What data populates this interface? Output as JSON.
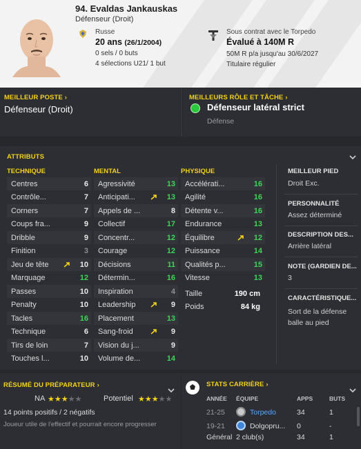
{
  "header": {
    "name": "94. Evaldas Jankauskas",
    "position": "Défenseur (Droit)",
    "nationality": "Russe",
    "age": "20 ans",
    "dob": "(26/1/2004)",
    "caps": "0 sels / 0 buts",
    "u21": "4 sélections U21/ 1 but",
    "contract": "Sous contrat avec le Torpedo",
    "value": "Évalué à 140M R",
    "wage": "50M R p/a jusqu'au 30/6/2027",
    "status": "Titulaire régulier"
  },
  "best_position": {
    "title": "Meilleur poste",
    "value": "Défenseur (Droit)"
  },
  "best_role": {
    "title": "Meilleurs rôle et tâche",
    "value": "Défenseur latéral strict",
    "sub": "Défense"
  },
  "attributes": {
    "title": "Attributs",
    "technique_title": "Technique",
    "mental_title": "Mental",
    "physique_title": "Physique",
    "technique": [
      {
        "name": "Centres",
        "value": "6",
        "color": "white"
      },
      {
        "name": "Contrôle...",
        "value": "7",
        "color": "white"
      },
      {
        "name": "Corners",
        "value": "7",
        "color": "white"
      },
      {
        "name": "Coups fra...",
        "value": "9",
        "color": "white"
      },
      {
        "name": "Dribble",
        "value": "9",
        "color": "white"
      },
      {
        "name": "Finition",
        "value": "3",
        "color": "grey"
      },
      {
        "name": "Jeu de tête",
        "value": "10",
        "color": "white",
        "trend": true
      },
      {
        "name": "Marquage",
        "value": "12",
        "color": "green"
      },
      {
        "name": "Passes",
        "value": "10",
        "color": "white"
      },
      {
        "name": "Penalty",
        "value": "10",
        "color": "white"
      },
      {
        "name": "Tacles",
        "value": "16",
        "color": "green"
      },
      {
        "name": "Technique",
        "value": "6",
        "color": "white"
      },
      {
        "name": "Tirs de loin",
        "value": "7",
        "color": "white"
      },
      {
        "name": "Touches l...",
        "value": "10",
        "color": "white"
      }
    ],
    "mental": [
      {
        "name": "Agressivité",
        "value": "13",
        "color": "green"
      },
      {
        "name": "Anticipati...",
        "value": "13",
        "color": "green",
        "trend": true
      },
      {
        "name": "Appels de ...",
        "value": "8",
        "color": "white"
      },
      {
        "name": "Collectif",
        "value": "17",
        "color": "green"
      },
      {
        "name": "Concentr...",
        "value": "12",
        "color": "green"
      },
      {
        "name": "Courage",
        "value": "12",
        "color": "green"
      },
      {
        "name": "Décisions",
        "value": "11",
        "color": "green"
      },
      {
        "name": "Détermin...",
        "value": "16",
        "color": "green"
      },
      {
        "name": "Inspiration",
        "value": "4",
        "color": "grey"
      },
      {
        "name": "Leadership",
        "value": "9",
        "color": "white",
        "trend": true
      },
      {
        "name": "Placement",
        "value": "13",
        "color": "green"
      },
      {
        "name": "Sang-froid",
        "value": "9",
        "color": "white",
        "trend": true
      },
      {
        "name": "Vision du j...",
        "value": "9",
        "color": "white"
      },
      {
        "name": "Volume de...",
        "value": "14",
        "color": "green"
      }
    ],
    "physique": [
      {
        "name": "Accélérati...",
        "value": "16",
        "color": "green"
      },
      {
        "name": "Agilité",
        "value": "16",
        "color": "green"
      },
      {
        "name": "Détente v...",
        "value": "16",
        "color": "green"
      },
      {
        "name": "Endurance",
        "value": "13",
        "color": "green"
      },
      {
        "name": "Équilibre",
        "value": "12",
        "color": "green",
        "trend": true
      },
      {
        "name": "Puissance",
        "value": "14",
        "color": "green"
      },
      {
        "name": "Qualités p...",
        "value": "15",
        "color": "green"
      },
      {
        "name": "Vitesse",
        "value": "13",
        "color": "green"
      }
    ],
    "height_label": "Taille",
    "height_value": "190 cm",
    "weight_label": "Poids",
    "weight_value": "84 kg"
  },
  "sidebar": {
    "foot_title": "Meilleur pied",
    "foot_value": "Droit Exc.",
    "personality_title": "Personnalité",
    "personality_value": "Assez déterminé",
    "description_title": "Description des...",
    "description_value": "Arrière latéral",
    "note_title": "Note (gardien de...",
    "note_value": "3",
    "traits_title": "Caractéristique...",
    "traits_value_1": "Sort de la défense",
    "traits_value_2": "balle au pied"
  },
  "coach_report": {
    "title": "Résumé du préparateur",
    "na_label": "NA",
    "na_stars": 3,
    "potential_label": "Potentiel",
    "potential_stars": 3,
    "points": "14 points positifs / 2 négatifs",
    "description": "Joueur utile de l'effectif et pourrait encore progresser"
  },
  "career": {
    "title": "Stats carrière",
    "headers": {
      "year": "Année",
      "team": "Équipe",
      "apps": "Apps",
      "goals": "Buts"
    },
    "rows": [
      {
        "year": "21-25",
        "team": "Torpedo",
        "apps": "34",
        "goals": "1"
      },
      {
        "year": "19-21",
        "team": "Dolgopru...",
        "apps": "0",
        "goals": "-"
      }
    ],
    "total_label": "Général",
    "total_clubs": "2 club(s)",
    "total_apps": "34",
    "total_goals": "1"
  },
  "colors": {
    "accent": "#f4d31a",
    "good": "#3fd45a",
    "link": "#5aa8ff"
  }
}
